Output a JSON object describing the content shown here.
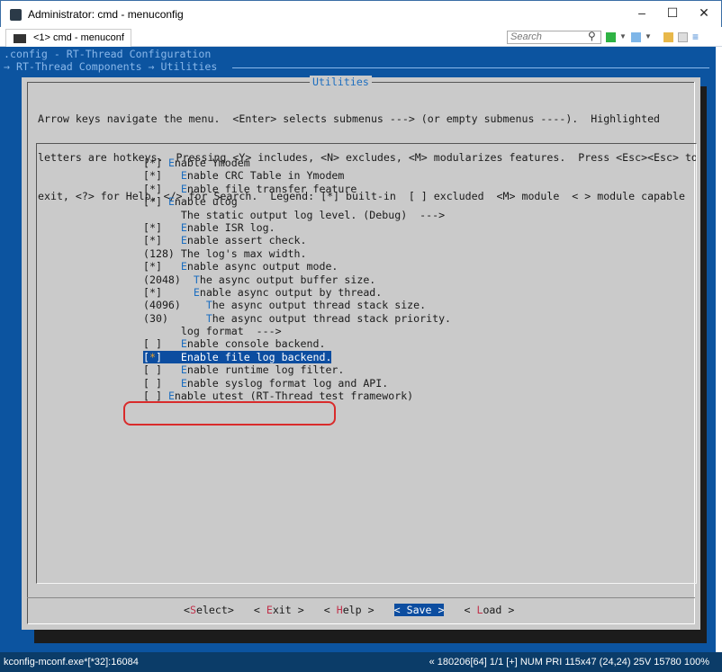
{
  "window": {
    "title": "Administrator: cmd - menuconfig",
    "minimize": "–",
    "maximize": "☐",
    "close": "✕"
  },
  "tabbar": {
    "tab_label": "<1> cmd - menuconf",
    "search_placeholder": "Search"
  },
  "toolbar_icons": [
    "search-icon",
    "new-console-icon",
    "dropdown-icon",
    "split-icon",
    "dropdown-icon",
    "lock-icon",
    "panel-icon",
    "menu-icon"
  ],
  "terminal": {
    "config_line": ".config - RT-Thread Configuration",
    "breadcrumb": "→ RT-Thread Components → Utilities",
    "dialog_title": "Utilities",
    "help_lines": [
      "Arrow keys navigate the menu.  <Enter> selects submenus ---> (or empty submenus ----).  Highlighted",
      "letters are hotkeys.  Pressing <Y> includes, <N> excludes, <M> modularizes features.  Press <Esc><Esc> to",
      "exit, <?> for Help, </> for Search.  Legend: [*] built-in  [ ] excluded  <M> module  < > module capable"
    ],
    "items": [
      {
        "mark": "[*]",
        "depth": 0,
        "label": "Enable Ymodem",
        "hotkey": true
      },
      {
        "mark": "[*]",
        "depth": 1,
        "label": "Enable CRC Table in Ymodem",
        "hotkey": true
      },
      {
        "mark": "[*]",
        "depth": 1,
        "label": "Enable file transfer feature",
        "hotkey": true
      },
      {
        "mark": "[*]",
        "depth": 0,
        "label": "Enable ulog",
        "hotkey": true
      },
      {
        "mark": "",
        "depth": 1,
        "label": "The static output log level. (Debug)  --->",
        "hotkey": false
      },
      {
        "mark": "[*]",
        "depth": 1,
        "label": "Enable ISR log.",
        "hotkey": true
      },
      {
        "mark": "[*]",
        "depth": 1,
        "label": "Enable assert check.",
        "hotkey": true
      },
      {
        "mark": "(128)",
        "depth": 0,
        "label": "The log's max width.",
        "hotkey": false
      },
      {
        "mark": "[*]",
        "depth": 1,
        "label": "Enable async output mode.",
        "hotkey": true
      },
      {
        "mark": "(2048)",
        "depth": 2,
        "label": "The async output buffer size.",
        "hotkey": true
      },
      {
        "mark": "[*]",
        "depth": 2,
        "label": "Enable async output by thread.",
        "hotkey": true
      },
      {
        "mark": "(4096)",
        "depth": 3,
        "label": "The async output thread stack size.",
        "hotkey": true
      },
      {
        "mark": "(30)",
        "depth": 3,
        "label": "The async output thread stack priority.",
        "hotkey": true
      },
      {
        "mark": "",
        "depth": 1,
        "label": "log format  --->",
        "hotkey": false
      },
      {
        "mark": "[ ]",
        "depth": 1,
        "label": "Enable console backend.",
        "hotkey": true
      },
      {
        "mark": "[*]",
        "depth": 1,
        "label": "Enable file log backend.",
        "hotkey": true,
        "selected": true
      },
      {
        "mark": "[ ]",
        "depth": 1,
        "label": "Enable runtime log filter.",
        "hotkey": true
      },
      {
        "mark": "[ ]",
        "depth": 1,
        "label": "Enable syslog format log and API.",
        "hotkey": true
      },
      {
        "mark": "[ ]",
        "depth": 0,
        "label": "Enable utest (RT-Thread test framework)",
        "hotkey": true
      }
    ],
    "buttons": [
      {
        "open": "<",
        "hotkey": "S",
        "rest": "elect",
        "close": ">",
        "active": false
      },
      {
        "open": "< ",
        "hotkey": "E",
        "rest": "xit",
        "close": " >",
        "active": false
      },
      {
        "open": "< ",
        "hotkey": "H",
        "rest": "elp",
        "close": " >",
        "active": false
      },
      {
        "open": "< ",
        "hotkey": "S",
        "rest": "ave",
        "close": " >",
        "active": true
      },
      {
        "open": "< ",
        "hotkey": "L",
        "rest": "oad",
        "close": " >",
        "active": false
      }
    ]
  },
  "statusbar": {
    "left": "kconfig-mconf.exe*[*32]:16084",
    "right": "« 180206[64]  1/1  [+] NUM  PRI  115x47  (24,24) 25V  15780 100%"
  },
  "colors": {
    "terminal_bg": "#0c54a0",
    "dialog_bg": "#cacaca",
    "hotkey": "#1e6fc0",
    "selection": "#0c4da0",
    "annotation": "#d92b2b"
  }
}
